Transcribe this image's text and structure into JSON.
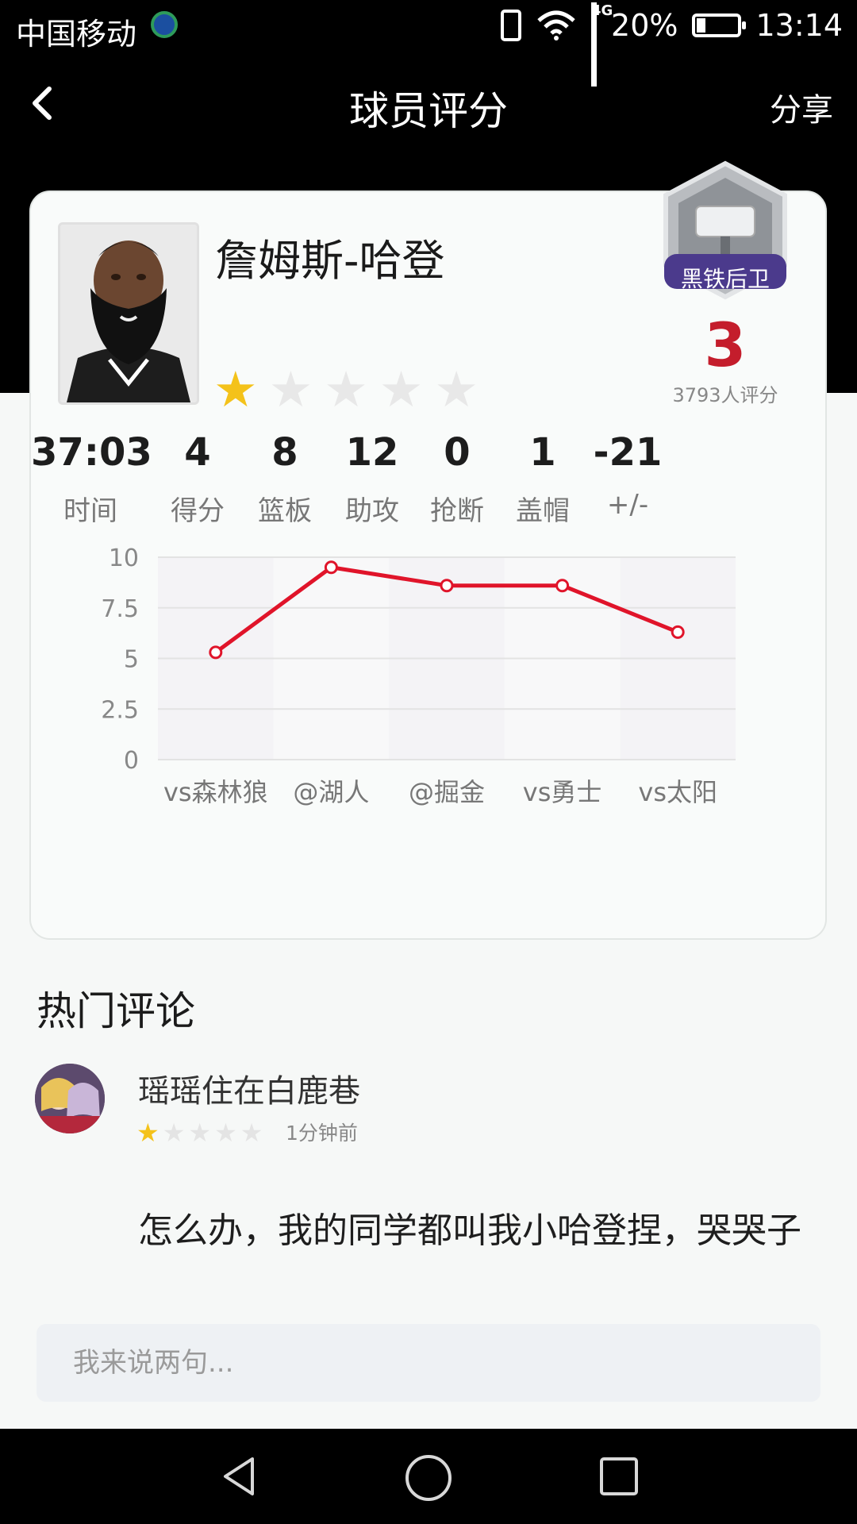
{
  "status_bar": {
    "carrier": "中国移动",
    "network": "4G",
    "battery": "20%",
    "battery_level": 0.2,
    "time": "13:14"
  },
  "nav": {
    "title": "球员评分",
    "share_label": "分享",
    "back_icon": "chevron-left-icon"
  },
  "player": {
    "name": "詹姆斯-哈登",
    "user_stars": 1,
    "star_total": 5,
    "badge_label": "黑铁后卫",
    "badge_icon": "hammer-icon",
    "score": "3",
    "rating_count": "3793人评分",
    "score_color": "#c41d2c"
  },
  "stats": [
    {
      "value": "37:03",
      "label": "时间"
    },
    {
      "value": "4",
      "label": "得分"
    },
    {
      "value": "8",
      "label": "篮板"
    },
    {
      "value": "12",
      "label": "助攻"
    },
    {
      "value": "0",
      "label": "抢断"
    },
    {
      "value": "1",
      "label": "盖帽"
    },
    {
      "value": "-21",
      "label": "+/-"
    }
  ],
  "chart_data": {
    "type": "line",
    "categories": [
      "vs森林狼",
      "@湖人",
      "@掘金",
      "vs勇士",
      "vs太阳"
    ],
    "values": [
      5.3,
      9.5,
      8.6,
      8.6,
      6.3
    ],
    "yticks": [
      "0",
      "2.5",
      "5",
      "7.5",
      "10"
    ],
    "ylim": [
      0,
      10
    ],
    "grid": true,
    "line_color": "#e0142a"
  },
  "comments_section": {
    "title": "热门评论",
    "comments": [
      {
        "user": "瑶瑶住在白鹿巷",
        "stars": 1,
        "time": "1分钟前",
        "text": "怎么办，我的同学都叫我小哈登捏，哭哭子"
      }
    ]
  },
  "input": {
    "placeholder": "我来说两句..."
  }
}
